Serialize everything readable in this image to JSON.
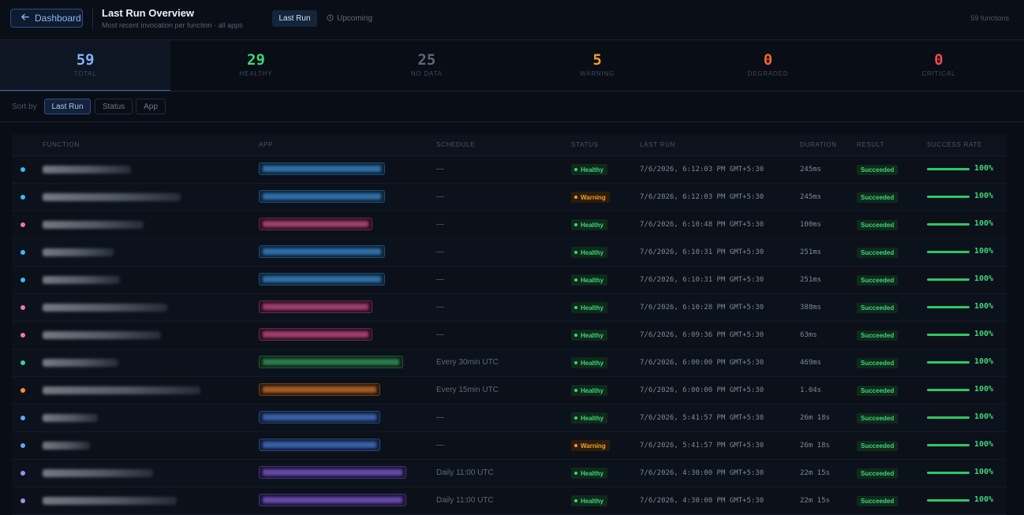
{
  "header": {
    "back_label": "Dashboard",
    "title": "Last Run Overview",
    "subtitle": "Most recent invocation per function · all apps",
    "tab_last_run": "Last Run",
    "tab_upcoming": "Upcoming",
    "function_count": "59 functions"
  },
  "stats": [
    {
      "value": "59",
      "label": "TOTAL",
      "color": "#7fb2f5"
    },
    {
      "value": "29",
      "label": "HEALTHY",
      "color": "#3ed57a"
    },
    {
      "value": "25",
      "label": "NO DATA",
      "color": "#5c6676"
    },
    {
      "value": "5",
      "label": "WARNING",
      "color": "#f59e2b"
    },
    {
      "value": "0",
      "label": "DEGRADED",
      "color": "#f06a2a"
    },
    {
      "value": "0",
      "label": "CRITICAL",
      "color": "#f04a4a"
    }
  ],
  "sort": {
    "label": "Sort by",
    "options": [
      "Last Run",
      "Status",
      "App"
    ],
    "selected": "Last Run"
  },
  "table": {
    "headers": [
      "FUNCTION",
      "APP",
      "SCHEDULE",
      "STATUS",
      "LAST RUN",
      "DURATION",
      "RESULT",
      "SUCCESS RATE"
    ],
    "rows": [
      {
        "dot": "#38bdf8",
        "app_color": "blue",
        "schedule": "—",
        "status": "Healthy",
        "last_run": "7/6/2026, 6:12:03 PM GMT+5:30",
        "duration": "245ms",
        "result": "Succeeded",
        "success_rate": "100%",
        "rate": 1.0
      },
      {
        "dot": "#38bdf8",
        "app_color": "blue",
        "schedule": "—",
        "status": "Warning",
        "last_run": "7/6/2026, 6:12:03 PM GMT+5:30",
        "duration": "245ms",
        "result": "Succeeded",
        "success_rate": "100%",
        "rate": 1.0
      },
      {
        "dot": "#f472b6",
        "app_color": "pink",
        "schedule": "—",
        "status": "Healthy",
        "last_run": "7/6/2026, 6:10:48 PM GMT+5:30",
        "duration": "100ms",
        "result": "Succeeded",
        "success_rate": "100%",
        "rate": 1.0
      },
      {
        "dot": "#38bdf8",
        "app_color": "blue",
        "schedule": "—",
        "status": "Healthy",
        "last_run": "7/6/2026, 6:10:31 PM GMT+5:30",
        "duration": "251ms",
        "result": "Succeeded",
        "success_rate": "100%",
        "rate": 1.0
      },
      {
        "dot": "#38bdf8",
        "app_color": "blue",
        "schedule": "—",
        "status": "Healthy",
        "last_run": "7/6/2026, 6:10:31 PM GMT+5:30",
        "duration": "251ms",
        "result": "Succeeded",
        "success_rate": "100%",
        "rate": 1.0
      },
      {
        "dot": "#f472b6",
        "app_color": "pink",
        "schedule": "—",
        "status": "Healthy",
        "last_run": "7/6/2026, 6:10:28 PM GMT+5:30",
        "duration": "388ms",
        "result": "Succeeded",
        "success_rate": "100%",
        "rate": 1.0
      },
      {
        "dot": "#f472b6",
        "app_color": "pink",
        "schedule": "—",
        "status": "Healthy",
        "last_run": "7/6/2026, 6:09:36 PM GMT+5:30",
        "duration": "63ms",
        "result": "Succeeded",
        "success_rate": "100%",
        "rate": 1.0
      },
      {
        "dot": "#34d399",
        "app_color": "green",
        "schedule": "Every 30min UTC",
        "status": "Healthy",
        "last_run": "7/6/2026, 6:00:00 PM GMT+5:30",
        "duration": "469ms",
        "result": "Succeeded",
        "success_rate": "100%",
        "rate": 1.0
      },
      {
        "dot": "#fb923c",
        "app_color": "orange",
        "schedule": "Every 15min UTC",
        "status": "Healthy",
        "last_run": "7/6/2026, 6:00:00 PM GMT+5:30",
        "duration": "1.04s",
        "result": "Succeeded",
        "success_rate": "100%",
        "rate": 1.0
      },
      {
        "dot": "#60a5fa",
        "app_color": "indigo",
        "schedule": "—",
        "status": "Healthy",
        "last_run": "7/6/2026, 5:41:57 PM GMT+5:30",
        "duration": "26m 18s",
        "result": "Succeeded",
        "success_rate": "100%",
        "rate": 1.0
      },
      {
        "dot": "#60a5fa",
        "app_color": "indigo",
        "schedule": "—",
        "status": "Warning",
        "last_run": "7/6/2026, 5:41:57 PM GMT+5:30",
        "duration": "26m 18s",
        "result": "Succeeded",
        "success_rate": "100%",
        "rate": 1.0
      },
      {
        "dot": "#a78bfa",
        "app_color": "purple",
        "schedule": "Daily 11:00 UTC",
        "status": "Healthy",
        "last_run": "7/6/2026, 4:30:00 PM GMT+5:30",
        "duration": "22m 15s",
        "result": "Succeeded",
        "success_rate": "100%",
        "rate": 1.0
      },
      {
        "dot": "#a78bfa",
        "app_color": "purple",
        "schedule": "Daily 11:00 UTC",
        "status": "Healthy",
        "last_run": "7/6/2026, 4:30:00 PM GMT+5:30",
        "duration": "22m 15s",
        "result": "Succeeded",
        "success_rate": "100%",
        "rate": 1.0
      }
    ]
  }
}
